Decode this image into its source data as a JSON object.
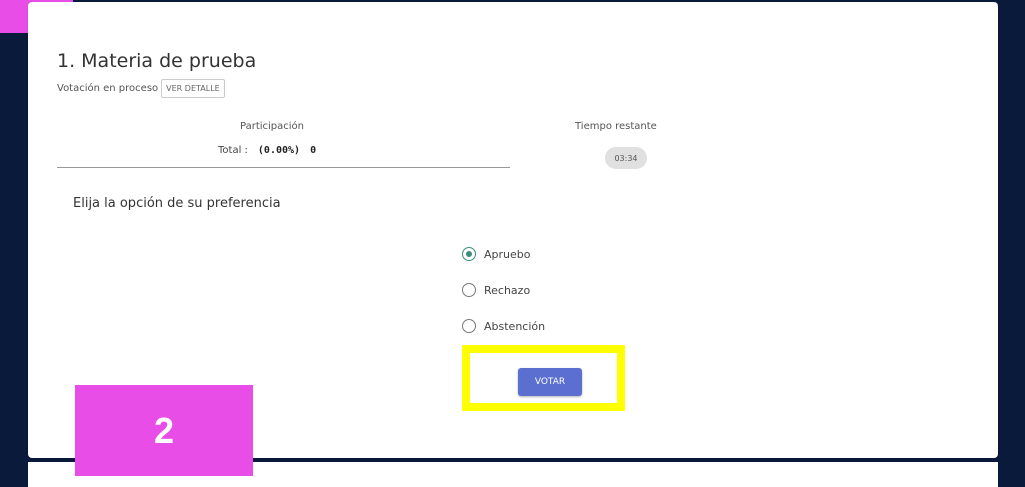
{
  "item": {
    "title": "1. Materia de prueba",
    "status": "Votación en proceso",
    "detail_button": "VER DETALLE"
  },
  "participation": {
    "label": "Participación",
    "total_label": "Total :",
    "total_percent": "(0.00%)",
    "total_count": "0"
  },
  "timer": {
    "label": "Tiempo restante",
    "value": "03:34"
  },
  "ballot": {
    "prompt": "Elija la opción de su preferencia",
    "options": [
      {
        "label": "Apruebo",
        "selected": true
      },
      {
        "label": "Rechazo",
        "selected": false
      },
      {
        "label": "Abstención",
        "selected": false
      }
    ],
    "submit_label": "VOTAR"
  },
  "annotation": {
    "step_number": "2",
    "badge_color": "#e84de8",
    "highlight_color": "#ffff00"
  },
  "colors": {
    "background": "#0a1a3a",
    "button": "#5a6fd0",
    "radio_selected": "#3a8f7a"
  }
}
